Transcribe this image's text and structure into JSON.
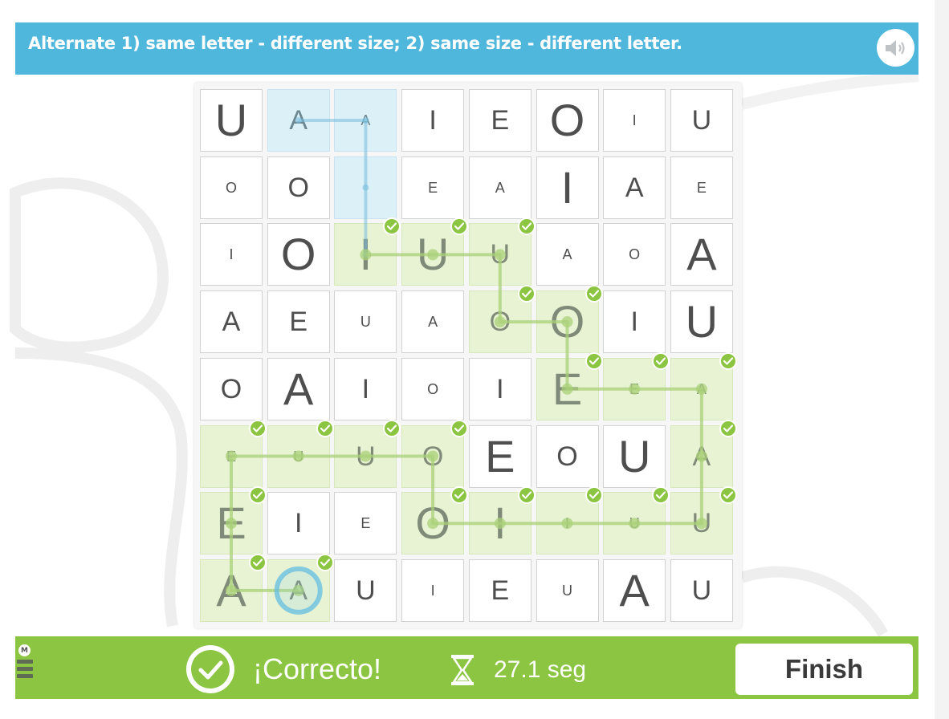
{
  "header": {
    "instruction": "Alternate 1) same letter - different size; 2) same size - different letter.",
    "sound_icon": "speaker-icon"
  },
  "board": {
    "rows": [
      [
        {
          "l": "U",
          "s": 3
        },
        {
          "l": "A",
          "s": 2,
          "st": "blue"
        },
        {
          "l": "A",
          "s": 1,
          "st": "blue"
        },
        {
          "l": "I",
          "s": 2
        },
        {
          "l": "E",
          "s": 2
        },
        {
          "l": "O",
          "s": 3
        },
        {
          "l": "I",
          "s": 1
        },
        {
          "l": "U",
          "s": 2
        }
      ],
      [
        {
          "l": "O",
          "s": 1
        },
        {
          "l": "O",
          "s": 2
        },
        {
          "l": "",
          "s": 1,
          "st": "blue"
        },
        {
          "l": "E",
          "s": 1
        },
        {
          "l": "A",
          "s": 1
        },
        {
          "l": "I",
          "s": 3
        },
        {
          "l": "A",
          "s": 2
        },
        {
          "l": "E",
          "s": 1
        }
      ],
      [
        {
          "l": "I",
          "s": 1
        },
        {
          "l": "O",
          "s": 3
        },
        {
          "l": "I",
          "s": 3,
          "st": "path",
          "c": true
        },
        {
          "l": "U",
          "s": 3,
          "st": "path",
          "c": true
        },
        {
          "l": "U",
          "s": 2,
          "st": "path",
          "c": true
        },
        {
          "l": "A",
          "s": 1
        },
        {
          "l": "O",
          "s": 1
        },
        {
          "l": "A",
          "s": 3
        }
      ],
      [
        {
          "l": "A",
          "s": 2
        },
        {
          "l": "E",
          "s": 2
        },
        {
          "l": "U",
          "s": 1
        },
        {
          "l": "A",
          "s": 1
        },
        {
          "l": "O",
          "s": 2,
          "st": "path",
          "c": true
        },
        {
          "l": "O",
          "s": 3,
          "st": "path",
          "c": true
        },
        {
          "l": "I",
          "s": 2
        },
        {
          "l": "U",
          "s": 3
        }
      ],
      [
        {
          "l": "O",
          "s": 2
        },
        {
          "l": "A",
          "s": 3
        },
        {
          "l": "I",
          "s": 2
        },
        {
          "l": "O",
          "s": 1
        },
        {
          "l": "I",
          "s": 2
        },
        {
          "l": "E",
          "s": 3,
          "st": "path",
          "c": true
        },
        {
          "l": "E",
          "s": 1,
          "st": "path",
          "c": true
        },
        {
          "l": "A",
          "s": 1,
          "st": "path",
          "c": true
        }
      ],
      [
        {
          "l": "E",
          "s": 1,
          "st": "path",
          "c": true
        },
        {
          "l": "U",
          "s": 1,
          "st": "path",
          "c": true
        },
        {
          "l": "U",
          "s": 2,
          "st": "path",
          "c": true
        },
        {
          "l": "O",
          "s": 2,
          "st": "path",
          "c": true
        },
        {
          "l": "E",
          "s": 3
        },
        {
          "l": "O",
          "s": 2
        },
        {
          "l": "U",
          "s": 3
        },
        {
          "l": "A",
          "s": 2,
          "st": "path",
          "c": true
        }
      ],
      [
        {
          "l": "E",
          "s": 3,
          "st": "path",
          "c": true
        },
        {
          "l": "I",
          "s": 2
        },
        {
          "l": "E",
          "s": 1
        },
        {
          "l": "O",
          "s": 3,
          "st": "path",
          "c": true
        },
        {
          "l": "I",
          "s": 3,
          "st": "path",
          "c": true
        },
        {
          "l": "I",
          "s": 1,
          "st": "path",
          "c": true
        },
        {
          "l": "U",
          "s": 1,
          "st": "path",
          "c": true
        },
        {
          "l": "U",
          "s": 2,
          "st": "path",
          "c": true
        }
      ],
      [
        {
          "l": "A",
          "s": 3,
          "st": "path",
          "c": true
        },
        {
          "l": "A",
          "s": 2,
          "st": "path",
          "c": true,
          "ring": true
        },
        {
          "l": "U",
          "s": 2
        },
        {
          "l": "I",
          "s": 1
        },
        {
          "l": "E",
          "s": 2
        },
        {
          "l": "U",
          "s": 1
        },
        {
          "l": "A",
          "s": 3
        },
        {
          "l": "U",
          "s": 2
        }
      ]
    ],
    "green_path": [
      [
        2,
        2
      ],
      [
        2,
        3
      ],
      [
        2,
        4
      ],
      [
        3,
        4
      ],
      [
        3,
        5
      ],
      [
        4,
        5
      ],
      [
        4,
        6
      ],
      [
        4,
        7
      ],
      [
        5,
        7
      ],
      [
        6,
        7
      ],
      [
        6,
        6
      ],
      [
        6,
        5
      ],
      [
        6,
        4
      ],
      [
        6,
        3
      ],
      [
        5,
        3
      ],
      [
        5,
        2
      ],
      [
        5,
        1
      ],
      [
        5,
        0
      ],
      [
        6,
        0
      ],
      [
        7,
        0
      ],
      [
        7,
        1
      ]
    ],
    "blue_path": [
      [
        0,
        1
      ],
      [
        0,
        2
      ],
      [
        1,
        2
      ],
      [
        2,
        2
      ]
    ],
    "colors": {
      "path_bg": "#e8f3d4",
      "blue_bg": "#dcf0f8",
      "check": "#8bc541"
    }
  },
  "footer": {
    "result_text": "¡Correcto!",
    "time_text": "27.1 seg",
    "finish_label": "Finish",
    "menu_badge": "M",
    "result_icon": "checkmark-circle-icon",
    "timer_icon": "hourglass-icon",
    "bg_color": "#8bc541"
  }
}
